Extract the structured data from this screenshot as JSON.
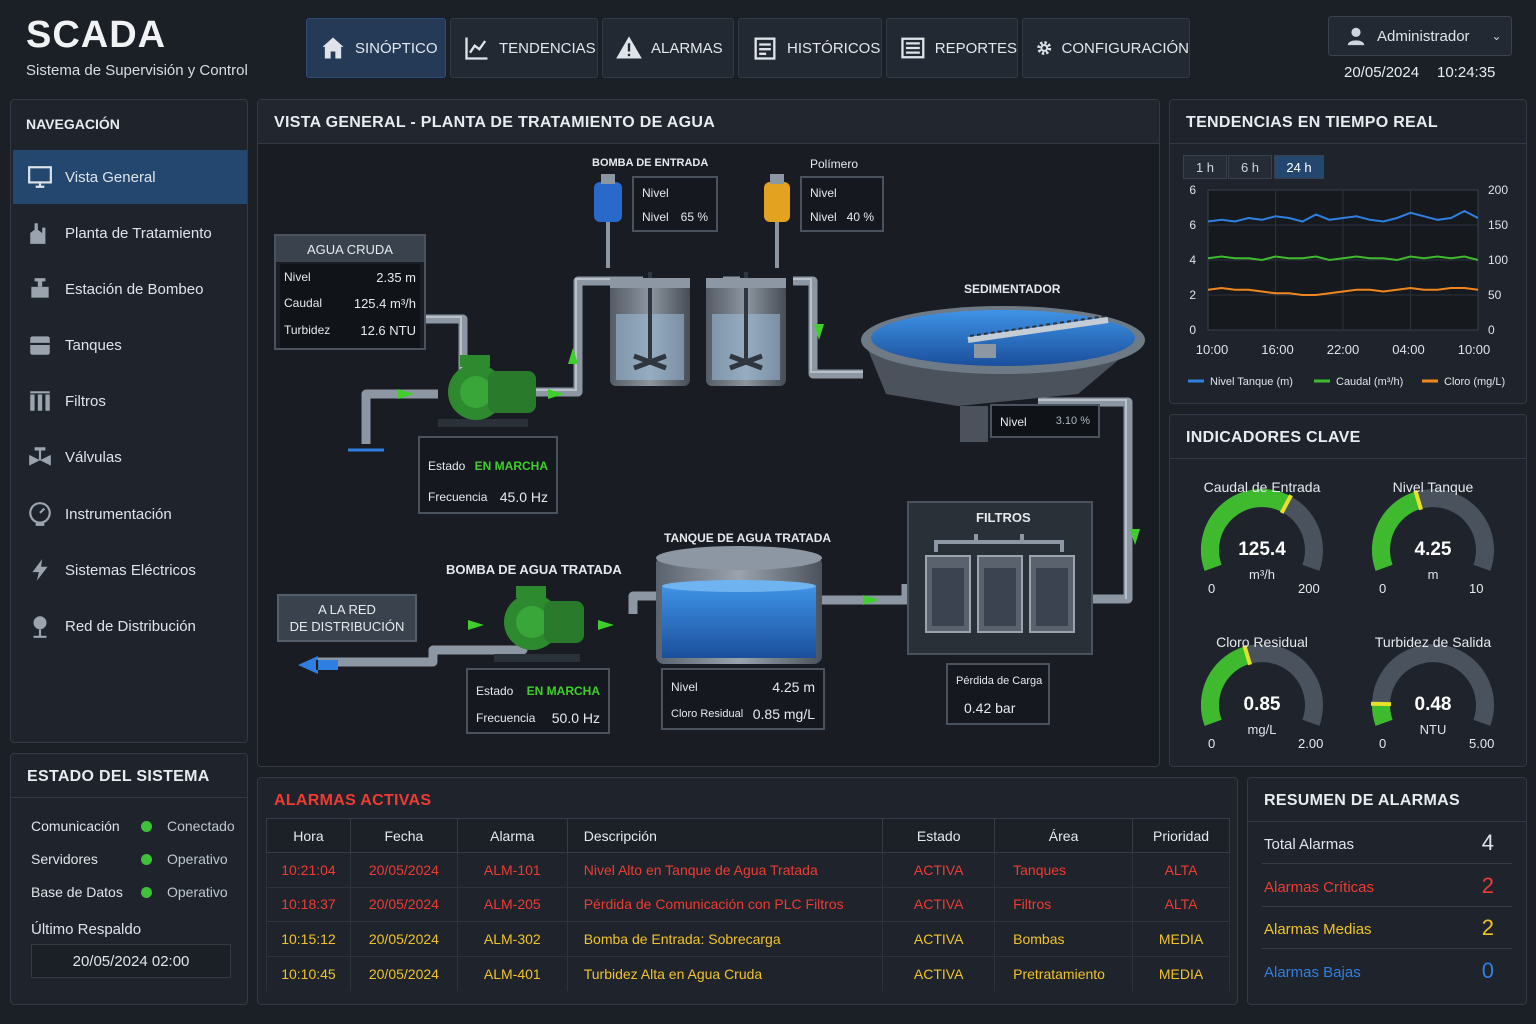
{
  "header": {
    "title": "SCADA",
    "subtitle": "Sistema de Supervisión y Control",
    "user": "Administrador",
    "date": "20/05/2024",
    "time": "10:24:35"
  },
  "tabs": [
    {
      "label": "SINÓPTICO",
      "icon": "home-icon"
    },
    {
      "label": "TENDENCIAS",
      "icon": "chart-icon"
    },
    {
      "label": "ALARMAS",
      "icon": "warning-icon"
    },
    {
      "label": "HISTÓRICOS",
      "icon": "calendar-icon"
    },
    {
      "label": "REPORTES",
      "icon": "report-icon"
    },
    {
      "label": "CONFIGURACIÓN",
      "icon": "gear-icon"
    }
  ],
  "sidebar": {
    "title": "NAVEGACIÓN",
    "items": [
      {
        "label": "Vista General"
      },
      {
        "label": "Planta de Tratamiento"
      },
      {
        "label": "Estación de Bombeo"
      },
      {
        "label": "Tanques"
      },
      {
        "label": "Filtros"
      },
      {
        "label": "Válvulas"
      },
      {
        "label": "Instrumentación"
      },
      {
        "label": "Sistemas Eléctricos"
      },
      {
        "label": "Red de Distribución"
      }
    ]
  },
  "system_status": {
    "title": "ESTADO DEL SISTEMA",
    "rows": [
      {
        "label": "Comunicación",
        "value": "Conectado"
      },
      {
        "label": "Servidores",
        "value": "Operativo"
      },
      {
        "label": "Base de Datos",
        "value": "Operativo"
      }
    ],
    "backup_label": "Último Respaldo",
    "backup_value": "20/05/2024 02:00"
  },
  "synoptic": {
    "title": "VISTA GENERAL - PLANTA DE TRATAMIENTO DE AGUA",
    "raw_water": {
      "title": "AGUA CRUDA",
      "rows": [
        {
          "label": "Nivel",
          "value": "2.35 m"
        },
        {
          "label": "Caudal",
          "value": "125.4 m³/h"
        },
        {
          "label": "Turbidez",
          "value": "12.6 NTU"
        }
      ]
    },
    "inlet_pump_label": "BOMBA DE ENTRADA",
    "inlet_pump_box": {
      "label1": "Nivel",
      "label2": "Nivel",
      "value": "65 %"
    },
    "polymer_label": "Polímero",
    "polymer_box": {
      "label1": "Nivel",
      "label2": "Nivel",
      "value": "40 %"
    },
    "pump1_status": {
      "state_label": "Estado",
      "state_value": "EN MARCHA",
      "freq_label": "Frecuencia",
      "freq_value": "45.0 Hz"
    },
    "sedimentador_label": "SEDIMENTADOR",
    "sedimentador_box": {
      "label": "Nivel",
      "value": "3.10 %"
    },
    "filters_label": "FILTROS",
    "filters_box": {
      "label": "Pérdida de Carga",
      "value": "0.42 bar"
    },
    "tank_label": "TANQUE DE AGUA TRATADA",
    "tank_box": {
      "level_label": "Nivel",
      "level_value": "4.25 m",
      "chlorine_label": "Cloro Residual",
      "chlorine_value": "0.85 mg/L"
    },
    "pump2_label": "BOMBA DE AGUA TRATADA",
    "pump2_status": {
      "state_label": "Estado",
      "state_value": "EN MARCHA",
      "freq_label": "Frecuencia",
      "freq_value": "50.0 Hz"
    },
    "network_label1": "A LA RED",
    "network_label2": "DE DISTRIBUCIÓN",
    "tank_level_fraction": 0.65
  },
  "trends": {
    "title": "TENDENCIAS EN TIEMPO REAL",
    "ranges": [
      "1 h",
      "6 h",
      "24 h"
    ],
    "active_range": "24 h"
  },
  "chart_data": {
    "type": "line",
    "x": [
      "10:00",
      "16:00",
      "22:00",
      "04:00",
      "10:00"
    ],
    "yleft_ticks": [
      "6",
      "6",
      "4",
      "2",
      "0"
    ],
    "yright_ticks": [
      "200",
      "150",
      "100",
      "50",
      "0"
    ],
    "ylim_left": [
      0,
      8
    ],
    "grid": true,
    "legend_position": "bottom",
    "series": [
      {
        "name": "Nivel Tanque (m)",
        "color": "#2f7fe0",
        "values": [
          6.2,
          6.3,
          6.2,
          6.4,
          6.3,
          6.5,
          6.4,
          6.2,
          6.6,
          6.3,
          6.4,
          6.5,
          6.3,
          6.2,
          6.4,
          6.7,
          6.5,
          6.3,
          6.4,
          6.8,
          6.4
        ]
      },
      {
        "name": "Caudal (m³/h)",
        "color": "#3fba2e",
        "values": [
          4.1,
          4.2,
          4.1,
          4.1,
          4.0,
          4.2,
          4.1,
          4.1,
          4.2,
          4.0,
          4.1,
          4.2,
          4.1,
          4.1,
          4.0,
          4.2,
          4.1,
          4.2,
          4.1,
          4.2,
          4.0
        ]
      },
      {
        "name": "Cloro (mg/L)",
        "color": "#f0871e",
        "values": [
          2.3,
          2.4,
          2.3,
          2.3,
          2.2,
          2.1,
          2.1,
          2.0,
          2.0,
          2.1,
          2.2,
          2.3,
          2.3,
          2.2,
          2.3,
          2.4,
          2.3,
          2.3,
          2.4,
          2.4,
          2.3
        ]
      }
    ]
  },
  "indicators": {
    "title": "INDICADORES CLAVE",
    "gauges": [
      {
        "title": "Caudal de Entrada",
        "value": "125.4",
        "unit": "m³/h",
        "min": "0",
        "max": "200",
        "fraction": 0.627
      },
      {
        "title": "Nivel Tanque",
        "value": "4.25",
        "unit": "m",
        "min": "0",
        "max": "10",
        "fraction": 0.425
      },
      {
        "title": "Cloro Residual",
        "value": "0.85",
        "unit": "mg/L",
        "min": "0",
        "max": "2.00",
        "fraction": 0.425
      },
      {
        "title": "Turbidez de Salida",
        "value": "0.48",
        "unit": "NTU",
        "min": "0",
        "max": "5.00",
        "fraction": 0.096
      }
    ]
  },
  "alarms": {
    "title": "ALARMAS ACTIVAS",
    "columns": [
      "Hora",
      "Fecha",
      "Alarma",
      "Descripción",
      "Estado",
      "Área",
      "Prioridad"
    ],
    "rows": [
      {
        "time": "10:21:04",
        "date": "20/05/2024",
        "code": "ALM-101",
        "desc": "Nivel Alto en Tanque de Agua Tratada",
        "state": "ACTIVA",
        "area": "Tanques",
        "priority": "ALTA"
      },
      {
        "time": "10:18:37",
        "date": "20/05/2024",
        "code": "ALM-205",
        "desc": "Pérdida de Comunicación con PLC Filtros",
        "state": "ACTIVA",
        "area": "Filtros",
        "priority": "ALTA"
      },
      {
        "time": "10:15:12",
        "date": "20/05/2024",
        "code": "ALM-302",
        "desc": "Bomba de Entrada: Sobrecarga",
        "state": "ACTIVA",
        "area": "Bombas",
        "priority": "MEDIA"
      },
      {
        "time": "10:10:45",
        "date": "20/05/2024",
        "code": "ALM-401",
        "desc": "Turbidez Alta en Agua Cruda",
        "state": "ACTIVA",
        "area": "Pretratamiento",
        "priority": "MEDIA"
      }
    ]
  },
  "summary": {
    "title": "RESUMEN DE ALARMAS",
    "rows": [
      {
        "label": "Total Alarmas",
        "value": "4",
        "color": "#e6eaee"
      },
      {
        "label": "Alarmas Críticas",
        "value": "2",
        "color": "#ef3b32"
      },
      {
        "label": "Alarmas Medias",
        "value": "2",
        "color": "#f0c22c"
      },
      {
        "label": "Alarmas Bajas",
        "value": "0",
        "color": "#2f7fe0"
      }
    ]
  }
}
